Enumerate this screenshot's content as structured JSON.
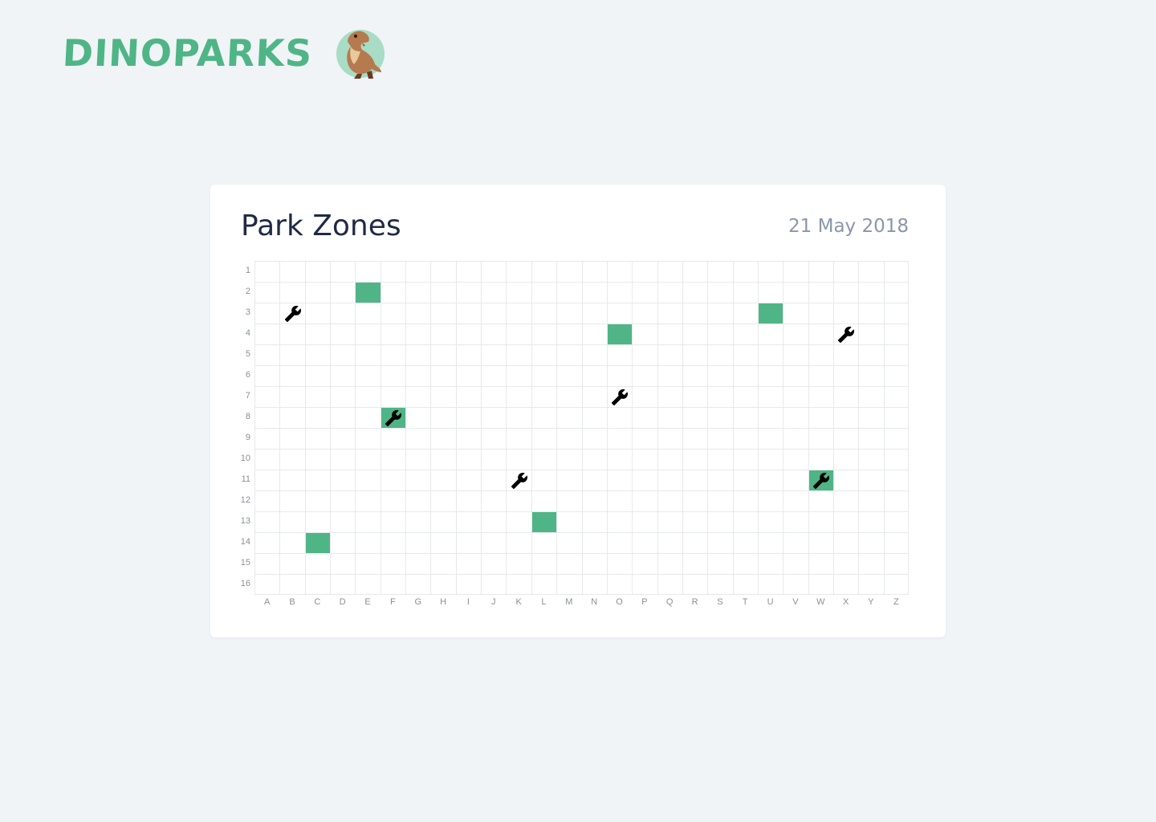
{
  "brand": {
    "name": "DINOPARKS",
    "icon": "t-rex-logo-icon",
    "color": "#4fb586"
  },
  "card": {
    "title": "Park Zones",
    "date": "21 May 2018"
  },
  "grid": {
    "columns": [
      "A",
      "B",
      "C",
      "D",
      "E",
      "F",
      "G",
      "H",
      "I",
      "J",
      "K",
      "L",
      "M",
      "N",
      "O",
      "P",
      "Q",
      "R",
      "S",
      "T",
      "U",
      "V",
      "W",
      "X",
      "Y",
      "Z"
    ],
    "rows": [
      "1",
      "2",
      "3",
      "4",
      "5",
      "6",
      "7",
      "8",
      "9",
      "10",
      "11",
      "12",
      "13",
      "14",
      "15",
      "16"
    ],
    "zones": [
      {
        "col": "E",
        "row": "2",
        "safe": true,
        "maintenance": false
      },
      {
        "col": "B",
        "row": "3",
        "safe": false,
        "maintenance": true
      },
      {
        "col": "U",
        "row": "3",
        "safe": true,
        "maintenance": false
      },
      {
        "col": "O",
        "row": "4",
        "safe": true,
        "maintenance": false
      },
      {
        "col": "X",
        "row": "4",
        "safe": false,
        "maintenance": true
      },
      {
        "col": "O",
        "row": "7",
        "safe": false,
        "maintenance": true
      },
      {
        "col": "F",
        "row": "8",
        "safe": true,
        "maintenance": true
      },
      {
        "col": "K",
        "row": "11",
        "safe": false,
        "maintenance": true
      },
      {
        "col": "W",
        "row": "11",
        "safe": true,
        "maintenance": true
      },
      {
        "col": "L",
        "row": "13",
        "safe": true,
        "maintenance": false
      },
      {
        "col": "C",
        "row": "14",
        "safe": true,
        "maintenance": false
      }
    ],
    "colors": {
      "safe": "#4fb586",
      "gridline": "#e6e9ec"
    },
    "maintenance_icon": "wrench-icon"
  }
}
